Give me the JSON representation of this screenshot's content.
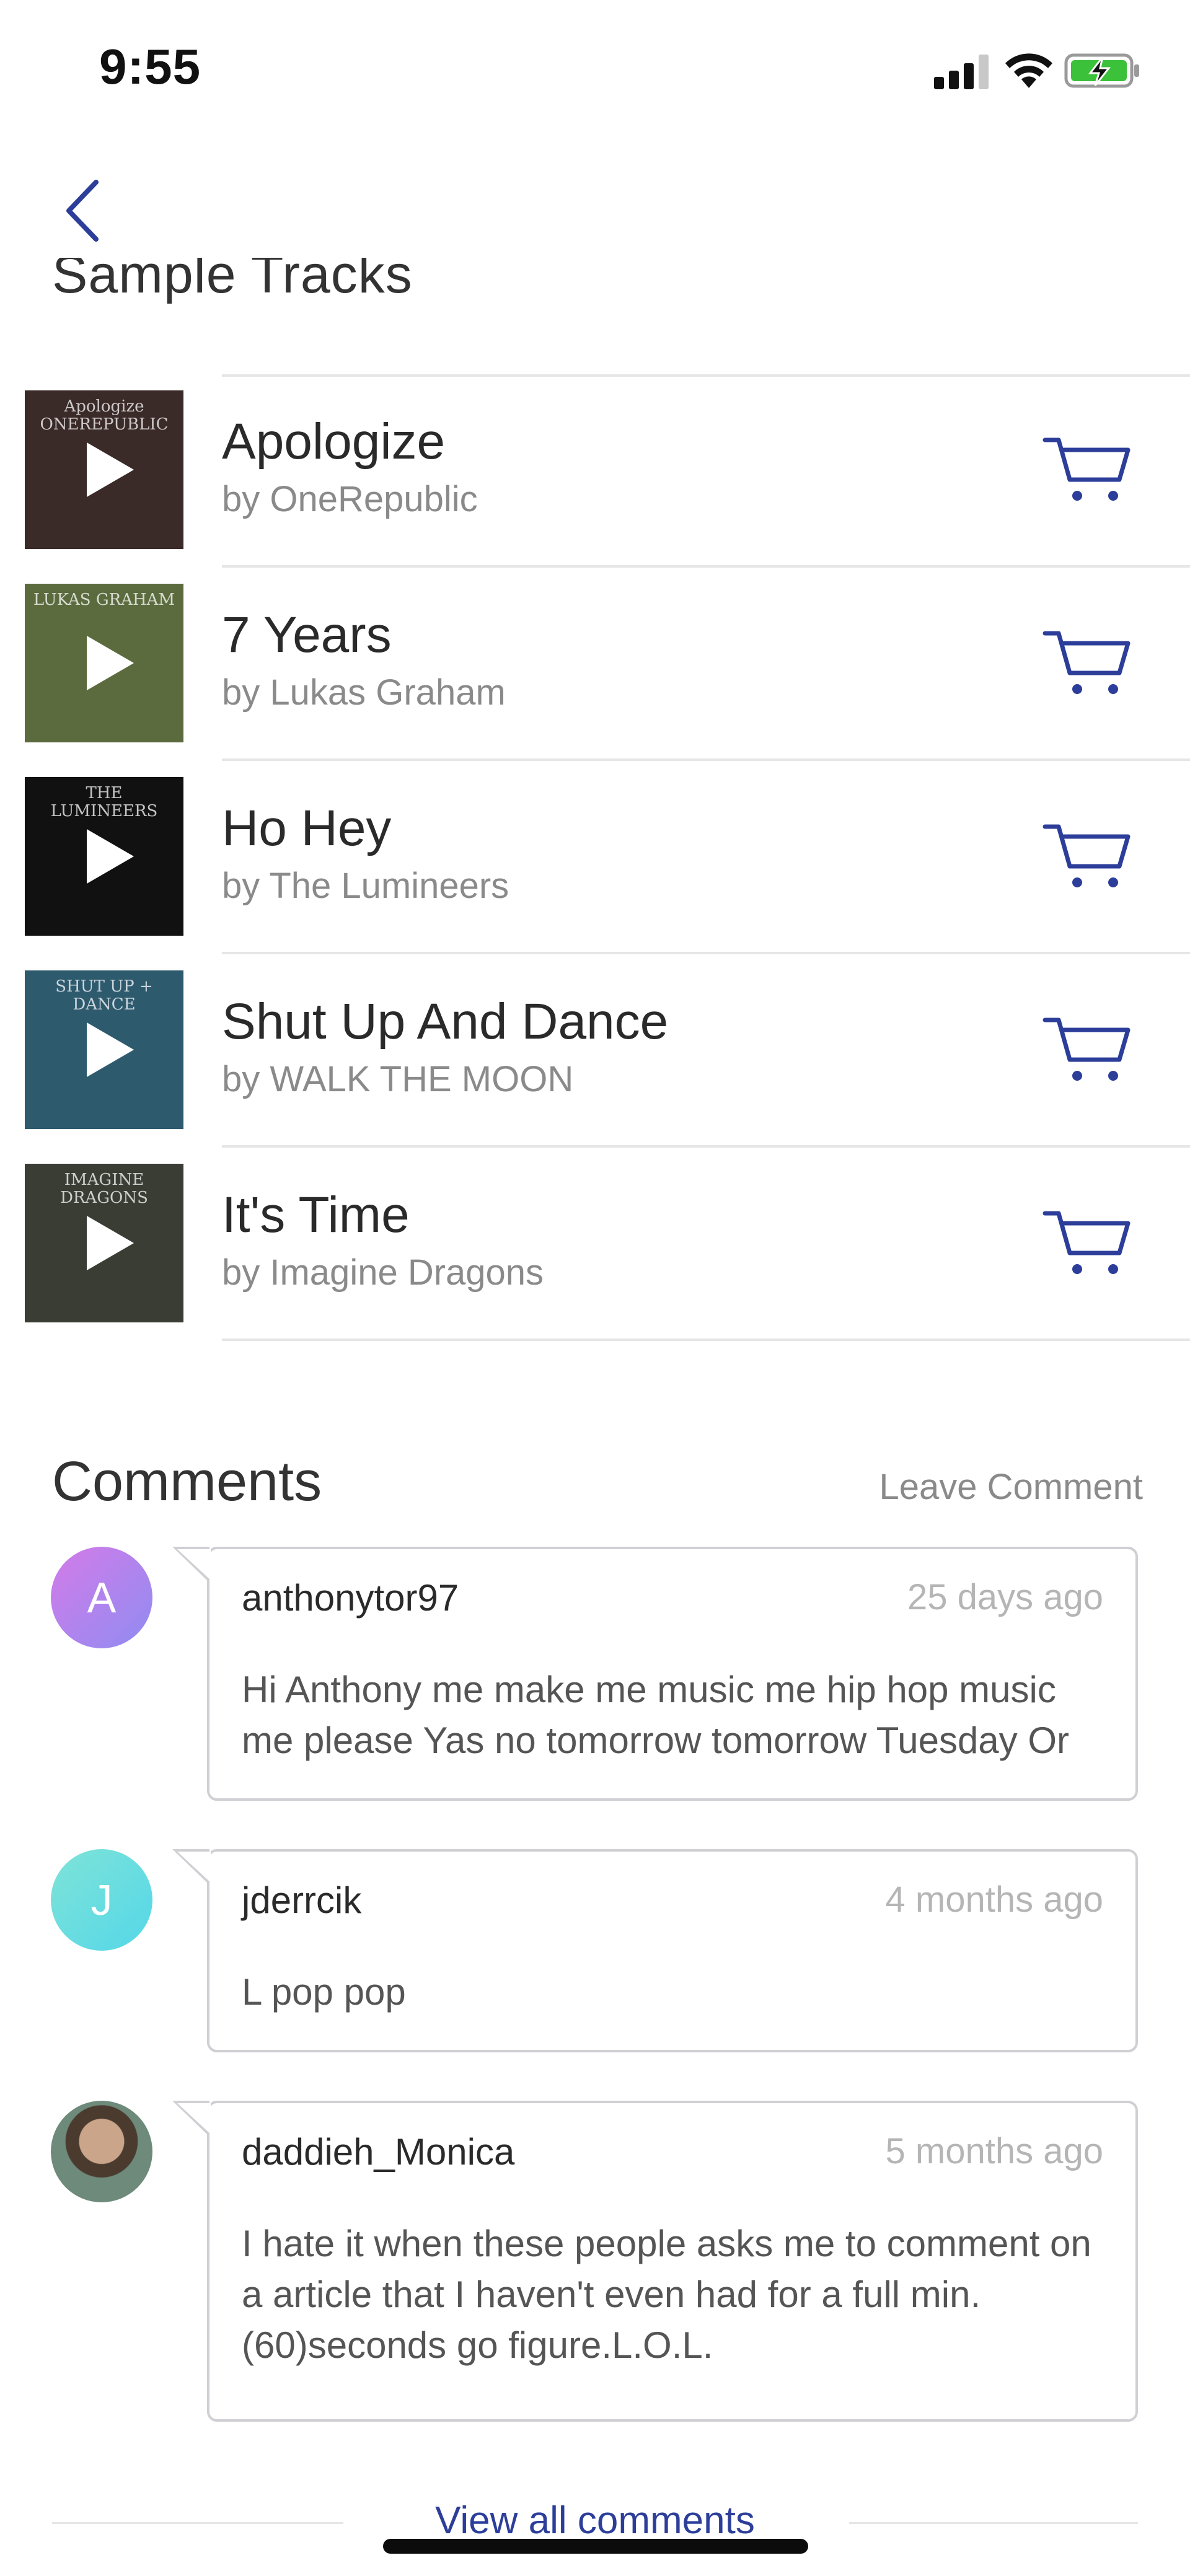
{
  "status_bar": {
    "time": "9:55"
  },
  "header": {
    "section_title": "Sample Tracks"
  },
  "colors": {
    "accent": "#2c3e9a",
    "divider": "#e6e6e6",
    "muted_text": "#8a8a8a"
  },
  "tracks": [
    {
      "title": "Apologize",
      "artist": "by OneRepublic",
      "cover_text": "Apologize ONEREPUBLIC",
      "cover_bg": "#3a2a28"
    },
    {
      "title": "7 Years",
      "artist": "by Lukas Graham",
      "cover_text": "LUKAS GRAHAM",
      "cover_bg": "#5b6b3e"
    },
    {
      "title": "Ho Hey",
      "artist": "by The Lumineers",
      "cover_text": "THE LUMINEERS",
      "cover_bg": "#111111"
    },
    {
      "title": "Shut Up And Dance",
      "artist": "by WALK THE MOON",
      "cover_text": "SHUT UP + DANCE",
      "cover_bg": "#2e5a6e"
    },
    {
      "title": "It's Time",
      "artist": "by Imagine Dragons",
      "cover_text": "IMAGINE DRAGONS",
      "cover_bg": "#3a3d34"
    }
  ],
  "comments_section": {
    "title": "Comments",
    "leave_comment": "Leave Comment",
    "view_all": "View all comments",
    "items": [
      {
        "avatar_letter": "A",
        "username": "anthonytor97",
        "time": "25 days ago",
        "text": "Hi Anthony me make me music me hip hop music me please Yas no tomorrow tomorrow Tuesday Or"
      },
      {
        "avatar_letter": "J",
        "username": "jderrcik",
        "time": "4 months ago",
        "text": "L pop pop"
      },
      {
        "avatar_letter": "",
        "username": "daddieh_Monica",
        "time": "5 months ago",
        "text": "I hate it when these people asks me to comment on a article that I haven't even had for a full min.(60)seconds go figure.L.O.L."
      }
    ]
  }
}
